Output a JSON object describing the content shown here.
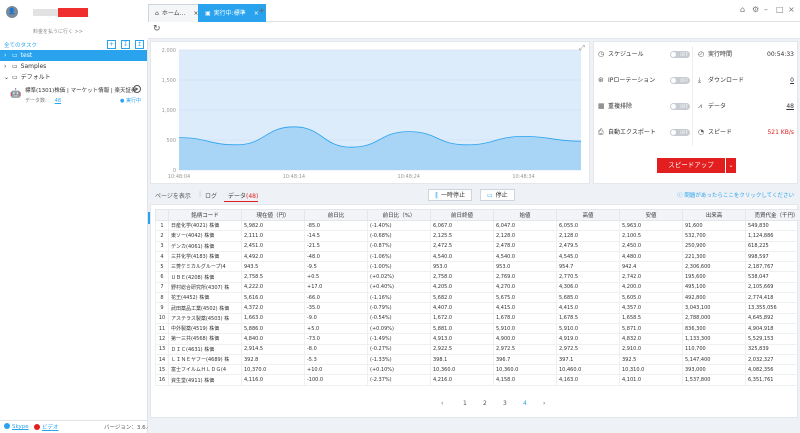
{
  "user": {
    "subtitle": "料金を払うに行く >>"
  },
  "tabs": [
    {
      "label": "ホーム...",
      "icon": "home-icon"
    },
    {
      "label": "実行中:標準",
      "icon": "task-icon"
    }
  ],
  "sidebar": {
    "title": "全てのタスク",
    "tree": [
      {
        "label": "test",
        "selected": true
      },
      {
        "label": "Samples",
        "selected": false
      },
      {
        "label": "デフォルト",
        "selected": false
      }
    ],
    "task": {
      "title": "標準(1301)株価 | マーケット情報 | 楽天証券",
      "count_label": "データ数:",
      "count": "48",
      "status": "実行中"
    }
  },
  "footer": {
    "skype": "Skype",
    "video": "ビデオ",
    "version": "バージョン：3.6.4"
  },
  "chart": {
    "y_ticks": [
      "2,000",
      "1,500",
      "1,000",
      "500",
      "0"
    ],
    "x_ticks": [
      "10:48:04",
      "10:48:14",
      "10:48:24",
      "10:48:34"
    ]
  },
  "chart_data": {
    "type": "area",
    "x": [
      "10:48:04",
      "10:48:09",
      "10:48:14",
      "10:48:19",
      "10:48:24",
      "10:48:29",
      "10:48:34",
      "10:48:38"
    ],
    "values": [
      540,
      420,
      720,
      380,
      640,
      420,
      560,
      480
    ],
    "ylim": [
      0,
      2000
    ],
    "x_ticks": [
      "10:48:04",
      "10:48:14",
      "10:48:24",
      "10:48:34"
    ],
    "y_ticks": [
      0,
      500,
      1000,
      1500,
      2000
    ],
    "grid": true,
    "color": "#2aa3ef"
  },
  "stats": {
    "schedule": {
      "label": "スケジュール",
      "toggle": "OFF"
    },
    "ip_rotation": {
      "label": "IPローテーション",
      "toggle": "OFF"
    },
    "dedup": {
      "label": "重複排除",
      "toggle": "OFF"
    },
    "auto_export": {
      "label": "自動エクスポート",
      "toggle": "OFF"
    },
    "runtime": {
      "label": "実行時間",
      "value": "00:54:33"
    },
    "download": {
      "label": "ダウンロード",
      "value": "0"
    },
    "data": {
      "label": "データ",
      "value": "48"
    },
    "speed": {
      "label": "スピード",
      "value": "521 KB/s"
    },
    "speedup_label": "スピードアップ",
    "accent": "#e21e1e"
  },
  "lower_tabs": {
    "show_page": "ページを表示",
    "log": "ログ",
    "data": "データ",
    "data_count": "(48)",
    "pause": "一時停止",
    "stop": "停止",
    "help": "問題があったらここをクリックしてください"
  },
  "table": {
    "headers": [
      "",
      "銘柄コード",
      "現在値（円）",
      "前日比",
      "前日比（%）",
      "前日終値",
      "始値",
      "高値",
      "安値",
      "出来高",
      "売買代金（千円）"
    ],
    "rows": [
      [
        "1",
        "日産化学(4021) 株価",
        "5,982.0",
        "-85.0",
        "(-1.40%)",
        "6,067.0",
        "6,047.0",
        "6,055.0",
        "5,963.0",
        "91,600",
        "549,830"
      ],
      [
        "2",
        "東ソー(4042) 株価",
        "2,111.0",
        "-14.5",
        "(-0.68%)",
        "2,125.5",
        "2,128.0",
        "2,128.0",
        "2,100.5",
        "532,700",
        "1,124,886"
      ],
      [
        "3",
        "デンカ(4061) 株価",
        "2,451.0",
        "-21.5",
        "(-0.87%)",
        "2,472.5",
        "2,478.0",
        "2,479.5",
        "2,450.0",
        "250,900",
        "618,225"
      ],
      [
        "4",
        "三井化学(4183) 株価",
        "4,492.0",
        "-48.0",
        "(-1.06%)",
        "4,540.0",
        "4,540.0",
        "4,545.0",
        "4,480.0",
        "221,300",
        "998,597"
      ],
      [
        "5",
        "三菱ケミカルグループ(4",
        "943.5",
        "-9.5",
        "(-1.00%)",
        "953.0",
        "953.0",
        "954.7",
        "942.4",
        "2,306,600",
        "2,187,767"
      ],
      [
        "6",
        "ＵＢＥ(4208) 株価",
        "2,758.5",
        "+0.5",
        "(+0.02%)",
        "2,758.0",
        "2,769.0",
        "2,770.5",
        "2,742.0",
        "195,600",
        "538,047"
      ],
      [
        "7",
        "野村総合研究所(4307) 株",
        "4,222.0",
        "+17.0",
        "(+0.40%)",
        "4,205.0",
        "4,270.0",
        "4,306.0",
        "4,200.0",
        "495,100",
        "2,105,669"
      ],
      [
        "8",
        "花王(4452) 株価",
        "5,616.0",
        "-66.0",
        "(-1.16%)",
        "5,682.0",
        "5,675.0",
        "5,685.0",
        "5,605.0",
        "492,800",
        "2,774,418"
      ],
      [
        "9",
        "武田薬品工業(4502) 株価",
        "4,372.0",
        "-35.0",
        "(-0.79%)",
        "4,407.0",
        "4,415.0",
        "4,415.0",
        "4,357.0",
        "3,043,100",
        "13,355,056"
      ],
      [
        "10",
        "アステラス製薬(4503) 株",
        "1,663.0",
        "-9.0",
        "(-0.54%)",
        "1,672.0",
        "1,678.0",
        "1,678.5",
        "1,658.5",
        "2,788,000",
        "4,645,892"
      ],
      [
        "11",
        "中外製薬(4519) 株価",
        "5,886.0",
        "+5.0",
        "(+0.09%)",
        "5,881.0",
        "5,910.0",
        "5,910.0",
        "5,871.0",
        "836,300",
        "4,904,918"
      ],
      [
        "12",
        "第一三共(4568) 株価",
        "4,840.0",
        "-73.0",
        "(-1.49%)",
        "4,913.0",
        "4,900.0",
        "4,919.0",
        "4,832.0",
        "1,133,300",
        "5,529,153"
      ],
      [
        "13",
        "ＤＩＣ(4631) 株価",
        "2,914.5",
        "-8.0",
        "(-0.27%)",
        "2,922.5",
        "2,972.5",
        "2,972.5",
        "2,910.0",
        "110,700",
        "325,839"
      ],
      [
        "14",
        "ＬＩＮＥヤフー(4689) 株",
        "392.8",
        "-5.3",
        "(-1.33%)",
        "398.1",
        "396.7",
        "397.1",
        "392.5",
        "5,147,400",
        "2,032,327"
      ],
      [
        "15",
        "富士フイルムＨＬＤＧ(4",
        "10,370.0",
        "+10.0",
        "(+0.10%)",
        "10,360.0",
        "10,360.0",
        "10,460.0",
        "10,310.0",
        "393,000",
        "4,082,356"
      ],
      [
        "16",
        "資生堂(4911) 株価",
        "4,116.0",
        "-100.0",
        "(-2.37%)",
        "4,216.0",
        "4,158.0",
        "4,163.0",
        "4,101.0",
        "1,537,800",
        "6,351,761"
      ]
    ]
  },
  "pager": {
    "prev": "‹",
    "pages": [
      "1",
      "2",
      "3",
      "4"
    ],
    "current": "4",
    "next": "›"
  }
}
